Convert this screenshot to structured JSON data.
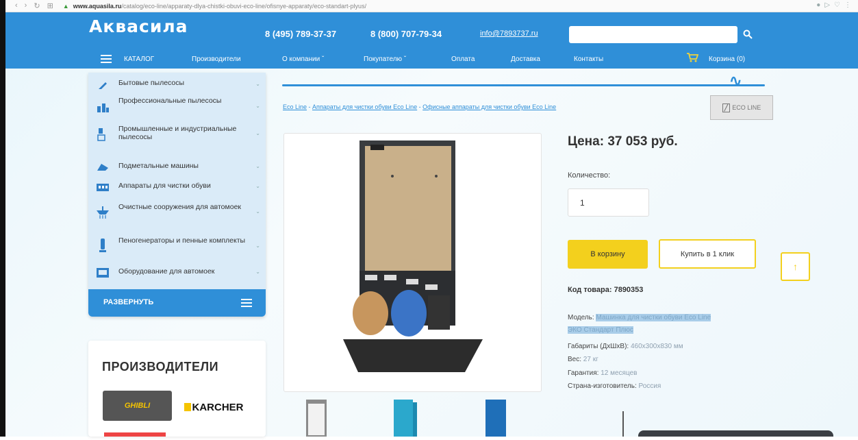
{
  "browser": {
    "url_host": "www.aquasila.ru",
    "url_path": "/catalog/eco-line/apparaty-dlya-chistki-obuvi-eco-line/ofisnye-apparaty/eco-standart-plyus/"
  },
  "header": {
    "logo": "Аквасила",
    "phone1": "8 (495) 789-37-37",
    "phone2": "8 (800) 707-79-34",
    "email": "info@7893737.ru",
    "search_placeholder": "",
    "search_icon": "search-icon"
  },
  "menu": {
    "catalog": "КАТАЛОГ",
    "items": [
      "Производители",
      "О компании",
      "Покупателю",
      "Оплата",
      "Доставка",
      "Контакты"
    ],
    "cart": "Корзина (0)"
  },
  "sidebar": {
    "items": [
      {
        "label": "Бытовые пылесосы",
        "icon": "vacuum-icon"
      },
      {
        "label": "Профессиональные пылесосы",
        "icon": "pro-vacuum-icon"
      },
      {
        "label": "Промышленные и индустриальные пылесосы",
        "icon": "industrial-vacuum-icon"
      },
      {
        "label": "Подметальные машины",
        "icon": "sweeper-icon"
      },
      {
        "label": "Аппараты для чистки обуви",
        "icon": "shoe-cleaner-icon"
      },
      {
        "label": "Очистные сооружения для автомоек",
        "icon": "water-treatment-icon"
      },
      {
        "label": "Пеногенераторы и пенные комплекты",
        "icon": "foam-generator-icon"
      },
      {
        "label": "Оборудование для автомоек",
        "icon": "carwash-equipment-icon"
      }
    ],
    "expand_label": "РАЗВЕРНУТЬ"
  },
  "brands": {
    "title": "ПРОИЗВОДИТЕЛИ",
    "items": [
      "GHIBLI",
      "KARCHER"
    ]
  },
  "breadcrumb": {
    "items": [
      "Eco Line",
      "Аппараты для чистки обуви Eco Line",
      "Офисные аппараты для чистки обуви Eco Line"
    ],
    "separator": " - "
  },
  "brand_logo": {
    "mark": "╱",
    "text": "ECO LINE"
  },
  "product": {
    "price": "Цена: 37 053 руб.",
    "qty_label": "Количество:",
    "qty_value": "1",
    "add_to_cart": "В корзину",
    "buy_one_click": "Купить в 1 клик",
    "sku": "Код товара: 7890353",
    "specs": [
      {
        "label": "Модель:",
        "value": "Машинка для чистки обуви Eco Line"
      },
      {
        "label": "",
        "value": "ЭКО Стандарт Плюс"
      },
      {
        "label": "Габариты (ДхШхВ):",
        "value": "460x300x830 мм"
      },
      {
        "label": "Вес:",
        "value": "27 кг"
      },
      {
        "label": "Гарантия:",
        "value": "12 месяцев"
      },
      {
        "label": "Страна-изготовитель:",
        "value": "Россия"
      }
    ]
  },
  "colors": {
    "brand_blue": "#2f8fd8",
    "sidebar_bg": "#daebf8",
    "button_yellow": "#f3d01d"
  }
}
